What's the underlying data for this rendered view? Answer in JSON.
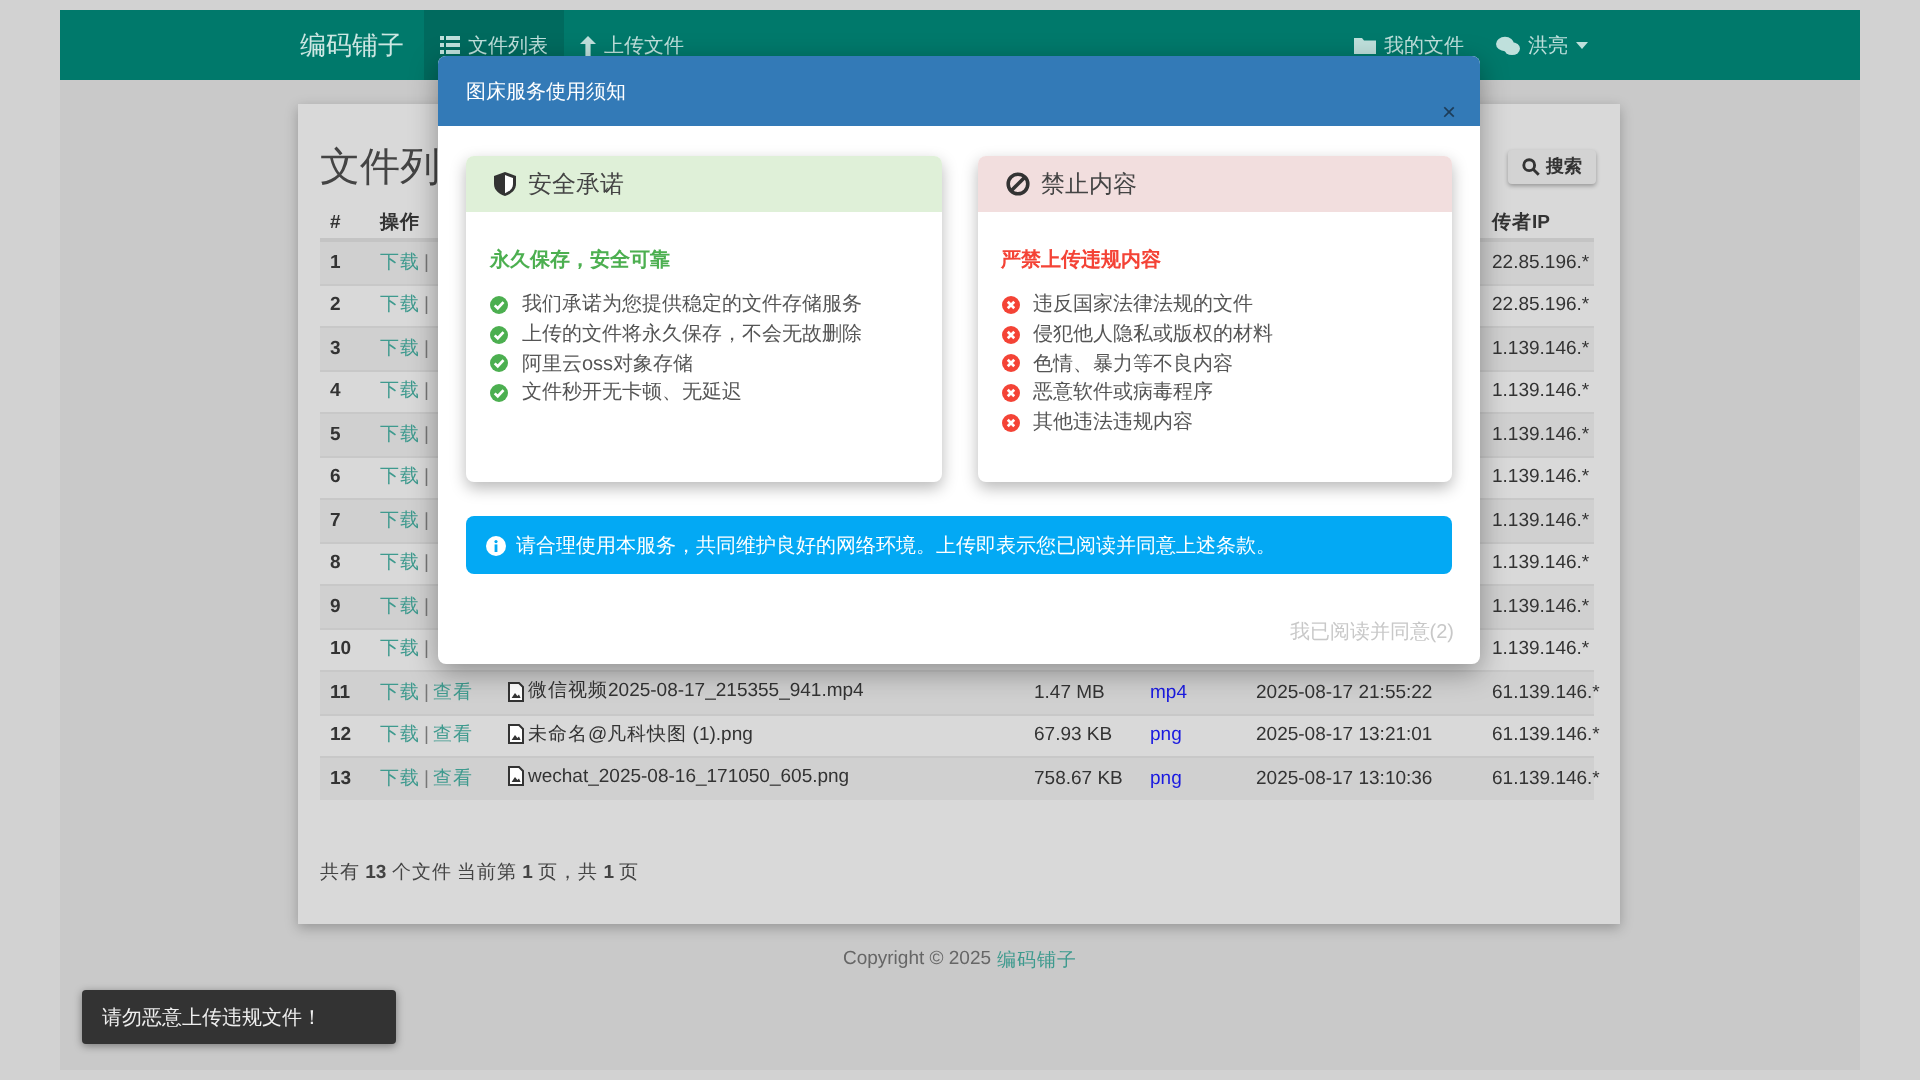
{
  "navbar": {
    "brand": "编码铺子",
    "items": [
      {
        "label": "文件列表",
        "selected": true
      },
      {
        "label": "上传文件",
        "selected": false
      }
    ],
    "right": [
      {
        "label": "我的文件",
        "dropdown": false
      },
      {
        "label": "洪亮",
        "dropdown": true
      }
    ]
  },
  "file_list": {
    "title": "文件列",
    "search_button": "搜索",
    "columns": {
      "number": "#",
      "actions": "操作",
      "uploader_ip": "传者IP"
    },
    "rows": [
      {
        "number": "1",
        "download": "下载",
        "separator": "|",
        "uploader_ip": "22.85.196.*"
      },
      {
        "number": "2",
        "download": "下载",
        "separator": "|",
        "uploader_ip": "22.85.196.*"
      },
      {
        "number": "3",
        "download": "下载",
        "separator": "|",
        "uploader_ip": "1.139.146.*"
      },
      {
        "number": "4",
        "download": "下载",
        "separator": "|",
        "uploader_ip": "1.139.146.*"
      },
      {
        "number": "5",
        "download": "下载",
        "separator": "|",
        "uploader_ip": "1.139.146.*"
      },
      {
        "number": "6",
        "download": "下载",
        "separator": "|",
        "uploader_ip": "1.139.146.*"
      },
      {
        "number": "7",
        "download": "下载",
        "separator": "|",
        "uploader_ip": "1.139.146.*"
      },
      {
        "number": "8",
        "download": "下载",
        "separator": "|",
        "uploader_ip": "1.139.146.*"
      },
      {
        "number": "9",
        "download": "下载",
        "separator": "|",
        "uploader_ip": "1.139.146.*"
      },
      {
        "number": "10",
        "download": "下载",
        "separator": "|",
        "uploader_ip": "1.139.146.*"
      },
      {
        "number": "11",
        "download": "下载",
        "separator": "|",
        "view": "查看",
        "name": "微信视频2025-08-17_215355_941.mp4",
        "size": "1.47 MB",
        "type": "mp4",
        "time": "2025-08-17 21:55:22",
        "uploader_ip": "61.139.146.*"
      },
      {
        "number": "12",
        "download": "下载",
        "separator": "|",
        "view": "查看",
        "name": "未命名@凡科快图 (1).png",
        "size": "67.93 KB",
        "type": "png",
        "time": "2025-08-17 13:21:01",
        "uploader_ip": "61.139.146.*"
      },
      {
        "number": "13",
        "download": "下载",
        "separator": "|",
        "view": "查看",
        "name": "wechat_2025-08-16_171050_605.png",
        "size": "758.67 KB",
        "type": "png",
        "time": "2025-08-17 13:10:36",
        "uploader_ip": "61.139.146.*"
      }
    ],
    "summary": "共有 **13** 个文件  当前第 **1** 页，共 **1** 页"
  },
  "footer": {
    "copyright": "Copyright © 2025",
    "link": "编码铺子"
  },
  "notice_dialog": {
    "title": "图床服务使用须知",
    "close": "×",
    "panels": [
      {
        "kind": "promise",
        "heading": "安全承诺",
        "subtitle": "永久保存，安全可靠",
        "items": [
          "我们承诺为您提供稳定的文件存储服务",
          "上传的文件将永久保存，不会无故删除",
          "阿里云oss对象存储",
          "文件秒开无卡顿、无延迟"
        ]
      },
      {
        "kind": "forbidden",
        "heading": "禁止内容",
        "subtitle": "严禁上传违规内容",
        "items": [
          "违反国家法律法规的文件",
          "侵犯他人隐私或版权的材料",
          "色情、暴力等不良内容",
          "恶意软件或病毒程序",
          "其他违法违规内容"
        ]
      }
    ],
    "info": "请合理使用本服务，共同维护良好的网络环境。上传即表示您已阅读并同意上述条款。",
    "confirm_button": {
      "label": "我已阅读并同意(2)",
      "disabled": true
    }
  },
  "toast": "请勿恶意上传违规文件！"
}
